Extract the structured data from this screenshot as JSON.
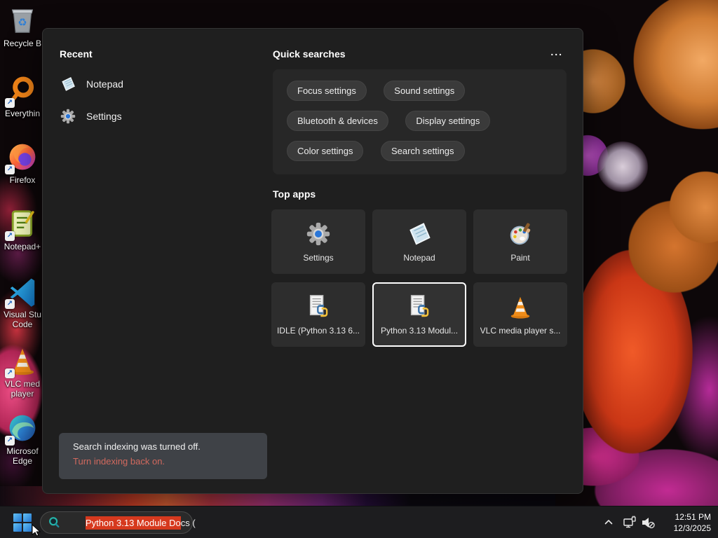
{
  "colors": {
    "selection_red": "#d6391e",
    "link_red": "#d1695e",
    "tile_selected_border": "#ffffff",
    "panel_bg": "#1f1f1f",
    "taskbar_bg": "#1d1d1f"
  },
  "desktop": {
    "icons": [
      {
        "label": "Recycle B"
      },
      {
        "label": "Everythin"
      },
      {
        "label": "Firefox"
      },
      {
        "label": "Notepad+"
      },
      {
        "label": "Visual Stu Code"
      },
      {
        "label": "VLC med player"
      },
      {
        "label": "Microsof Edge"
      }
    ]
  },
  "search_panel": {
    "recent": {
      "title": "Recent",
      "items": [
        {
          "label": "Notepad",
          "icon": "notepad-icon"
        },
        {
          "label": "Settings",
          "icon": "gear-icon"
        }
      ]
    },
    "quick_searches": {
      "title": "Quick searches",
      "more": "...",
      "pills": [
        "Focus settings",
        "Sound settings",
        "Bluetooth & devices",
        "Display settings",
        "Color settings",
        "Search settings"
      ]
    },
    "top_apps": {
      "title": "Top apps",
      "tiles": [
        {
          "label": "Settings",
          "icon": "gear-icon"
        },
        {
          "label": "Notepad",
          "icon": "notepad-icon"
        },
        {
          "label": "Paint",
          "icon": "paint-icon"
        },
        {
          "label": "IDLE (Python 3.13 6...",
          "icon": "python-doc-icon"
        },
        {
          "label": "Python 3.13 Modul...",
          "icon": "python-doc-icon",
          "selected": true
        },
        {
          "label": "VLC media player s...",
          "icon": "vlc-cone-icon"
        }
      ]
    },
    "notification": {
      "message": "Search indexing was turned off.",
      "link": "Turn indexing back on."
    }
  },
  "taskbar": {
    "search": {
      "selected_text": "Python 3.13 Module Do",
      "rest_text": "cs ("
    },
    "tray": {
      "time": "12:51 PM",
      "date": "12/3/2025"
    }
  }
}
